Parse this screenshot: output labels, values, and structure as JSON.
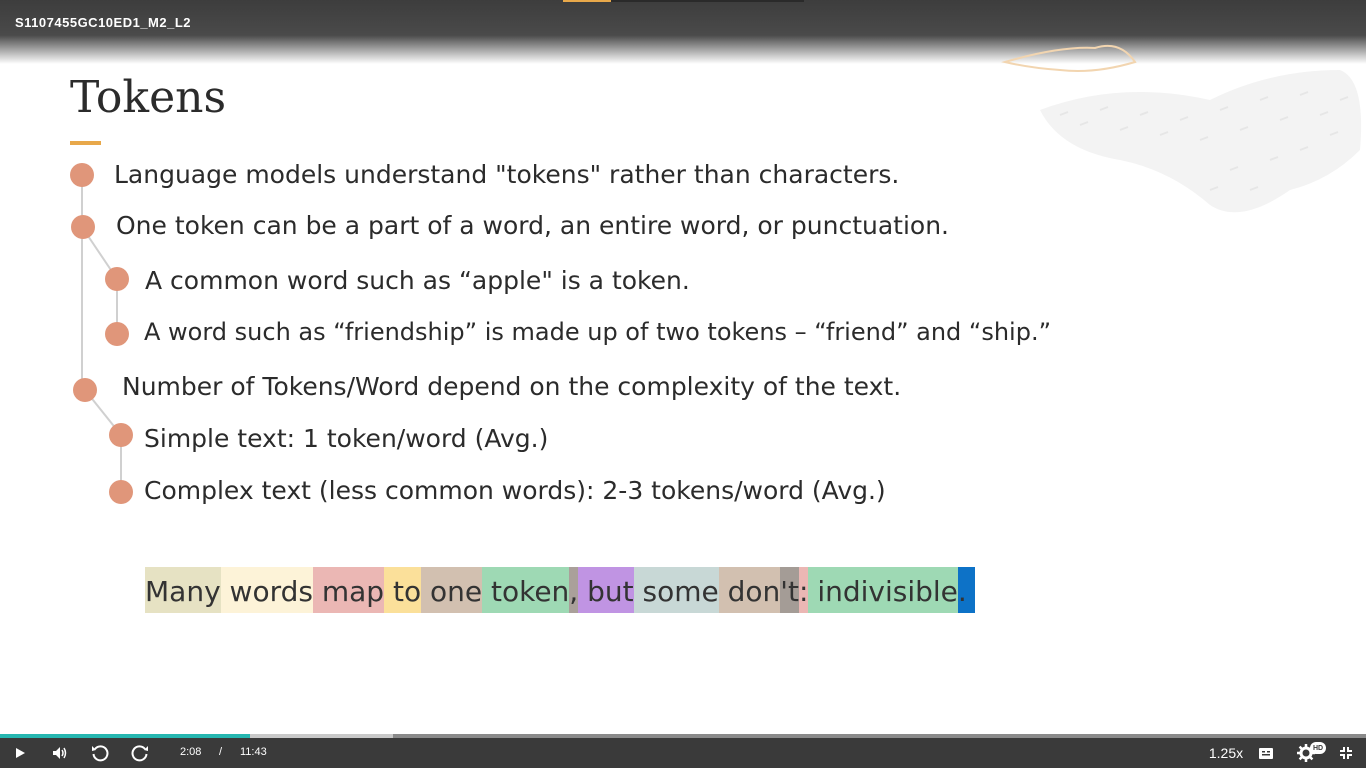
{
  "player": {
    "title": "S1107455GC10ED1_M2_L2",
    "current_time": "2:08",
    "time_separator": "/",
    "duration": "11:43",
    "speed": "1.25x",
    "hd_badge": "HD",
    "progress_fraction": 0.183,
    "buffered_fraction": 0.288
  },
  "slide": {
    "title": "Tokens",
    "bullets": [
      {
        "text": "Language models understand \"tokens\" rather than characters.",
        "level": 0
      },
      {
        "text": "One token can be a part of a word, an entire word, or punctuation.",
        "level": 0
      },
      {
        "text": "A common word such as “apple\" is a token.",
        "level": 1
      },
      {
        "text": "A word such as “friendship” is made up of two tokens – “friend” and “ship.”",
        "level": 1
      },
      {
        "text": "Number of Tokens/Word depend on the complexity of the text.",
        "level": 0
      },
      {
        "text": "Simple text: 1 token/word (Avg.)",
        "level": 1
      },
      {
        "text": "Complex text (less common words): 2-3 tokens/word (Avg.)",
        "level": 1
      }
    ],
    "tokens": [
      {
        "text": "Many",
        "color": "#e6e2c3"
      },
      {
        "text": " words",
        "color": "#fdf3d8"
      },
      {
        "text": " map",
        "color": "#ebb7b4"
      },
      {
        "text": " to",
        "color": "#fbe09a"
      },
      {
        "text": " one",
        "color": "#d2c0b0"
      },
      {
        "text": " token",
        "color": "#9ed9b4"
      },
      {
        "text": ",",
        "color": "#aaa09a"
      },
      {
        "text": " but",
        "color": "#c094e3"
      },
      {
        "text": " some",
        "color": "#c8d8d6"
      },
      {
        "text": " don",
        "color": "#d2c0b0"
      },
      {
        "text": "'t",
        "color": "#a49c96"
      },
      {
        "text": ":",
        "color": "#ebb7b4"
      },
      {
        "text": " indivisible",
        "color": "#9ed9b4"
      },
      {
        "text": "",
        "color": "#a6b6cf"
      },
      {
        "text": ".",
        "color": "#0d72c7"
      }
    ]
  },
  "colors": {
    "accent": "#e8a84a",
    "bullet_dot": "#e0967a",
    "progress": "#26b7b1"
  },
  "icons": [
    "play-icon",
    "volume-icon",
    "replay-icon",
    "forward-icon",
    "captions-icon",
    "settings-icon",
    "fullscreen-icon"
  ]
}
